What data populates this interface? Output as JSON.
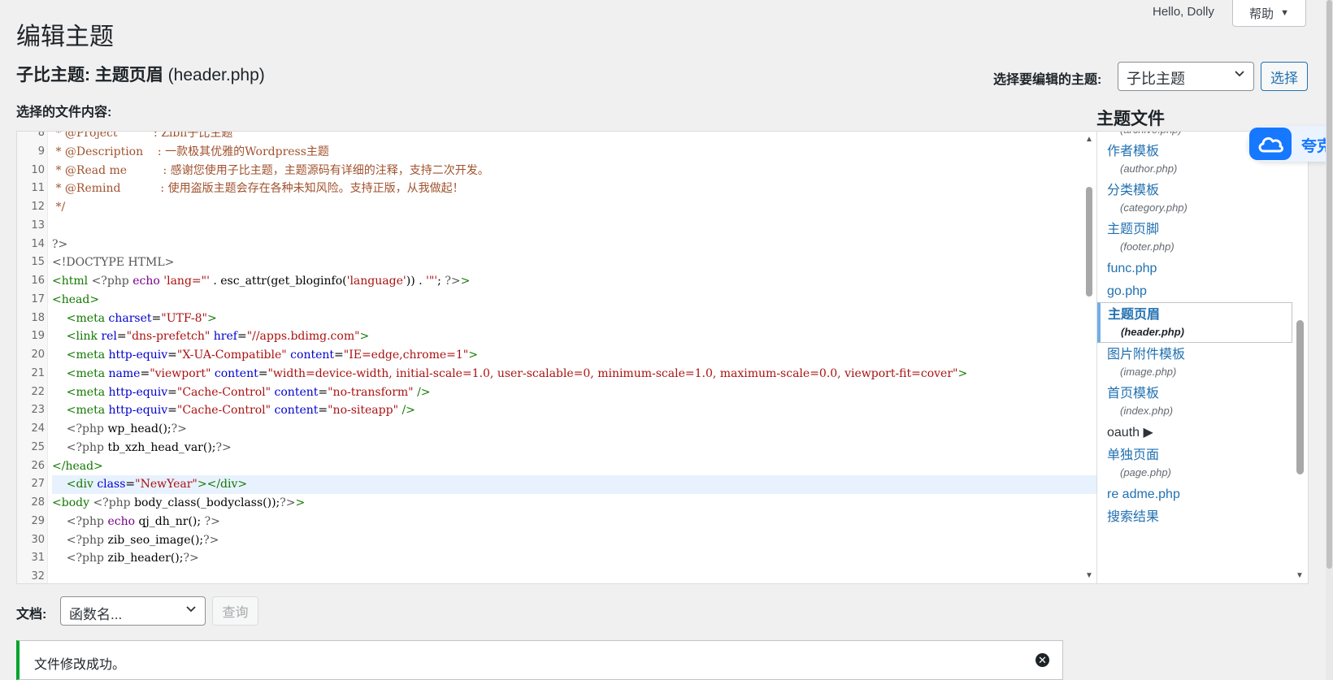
{
  "topbar": {
    "greeting": "Hello, Dolly",
    "help_label": "帮助",
    "help_caret": "▼"
  },
  "page": {
    "title": "编辑主题",
    "file_heading_theme": "子比主题: 主题页眉",
    "file_heading_file": "(header.php)",
    "select_theme_label": "选择要编辑的主题:",
    "selected_theme": "子比主题",
    "select_button": "选择",
    "content_label": "选择的文件内容:",
    "theme_files_title": "主题文件"
  },
  "editor": {
    "lines": [
      {
        "n": "8",
        "parts": [
          [
            "cm-comment",
            " * @Project          : Zibll子比主题"
          ]
        ]
      },
      {
        "n": "9",
        "parts": [
          [
            "cm-comment",
            " * @Description    : 一款极其优雅的Wordpress主题"
          ]
        ]
      },
      {
        "n": "10",
        "parts": [
          [
            "cm-comment",
            " * @Read me          : 感谢您使用子比主题，主题源码有详细的注释，支持二次开发。"
          ]
        ]
      },
      {
        "n": "11",
        "parts": [
          [
            "cm-comment",
            " * @Remind           : 使用盗版主题会存在各种未知风险。支持正版，从我做起！"
          ]
        ]
      },
      {
        "n": "12",
        "parts": [
          [
            "cm-comment",
            " */"
          ]
        ]
      },
      {
        "n": "13",
        "parts": []
      },
      {
        "n": "14",
        "parts": [
          [
            "cm-meta",
            "?>"
          ]
        ]
      },
      {
        "n": "15",
        "parts": [
          [
            "cm-meta",
            "<!DOCTYPE HTML>"
          ]
        ]
      },
      {
        "n": "16",
        "parts": [
          [
            "cm-tag",
            "<html "
          ],
          [
            "cm-meta",
            "<?php "
          ],
          [
            "cm-kw",
            "echo "
          ],
          [
            "cm-str",
            "'lang=\"' "
          ],
          [
            "cm-plain",
            ". esc_attr(get_bloginfo("
          ],
          [
            "cm-str",
            "'language'"
          ],
          [
            "cm-plain",
            ")) . "
          ],
          [
            "cm-str",
            "'\"'"
          ],
          [
            "cm-plain",
            "; "
          ],
          [
            "cm-meta",
            "?>"
          ],
          [
            "cm-tag",
            ">"
          ]
        ]
      },
      {
        "n": "17",
        "parts": [
          [
            "cm-tag",
            "<head>"
          ]
        ]
      },
      {
        "n": "18",
        "parts": [
          [
            "cm-tag",
            "    <meta "
          ],
          [
            "cm-attr",
            "charset"
          ],
          [
            "cm-plain",
            "="
          ],
          [
            "cm-str",
            "\"UTF-8\""
          ],
          [
            "cm-tag",
            ">"
          ]
        ]
      },
      {
        "n": "19",
        "parts": [
          [
            "cm-tag",
            "    <link "
          ],
          [
            "cm-attr",
            "rel"
          ],
          [
            "cm-plain",
            "="
          ],
          [
            "cm-str",
            "\"dns-prefetch\" "
          ],
          [
            "cm-attr",
            "href"
          ],
          [
            "cm-plain",
            "="
          ],
          [
            "cm-str",
            "\"//apps.bdimg.com\""
          ],
          [
            "cm-tag",
            ">"
          ]
        ]
      },
      {
        "n": "20",
        "parts": [
          [
            "cm-tag",
            "    <meta "
          ],
          [
            "cm-attr",
            "http-equiv"
          ],
          [
            "cm-plain",
            "="
          ],
          [
            "cm-str",
            "\"X-UA-Compatible\" "
          ],
          [
            "cm-attr",
            "content"
          ],
          [
            "cm-plain",
            "="
          ],
          [
            "cm-str",
            "\"IE=edge,chrome=1\""
          ],
          [
            "cm-tag",
            ">"
          ]
        ]
      },
      {
        "n": "21",
        "parts": [
          [
            "cm-tag",
            "    <meta "
          ],
          [
            "cm-attr",
            "name"
          ],
          [
            "cm-plain",
            "="
          ],
          [
            "cm-str",
            "\"viewport\" "
          ],
          [
            "cm-attr",
            "content"
          ],
          [
            "cm-plain",
            "="
          ],
          [
            "cm-str",
            "\"width=device-width, initial-scale=1.0, user-scalable=0, minimum-scale=1.0, maximum-scale=0.0, viewport-fit=cover\""
          ],
          [
            "cm-tag",
            ">"
          ]
        ]
      },
      {
        "n": "22",
        "parts": [
          [
            "cm-tag",
            "    <meta "
          ],
          [
            "cm-attr",
            "http-equiv"
          ],
          [
            "cm-plain",
            "="
          ],
          [
            "cm-str",
            "\"Cache-Control\" "
          ],
          [
            "cm-attr",
            "content"
          ],
          [
            "cm-plain",
            "="
          ],
          [
            "cm-str",
            "\"no-transform\" "
          ],
          [
            "cm-tag",
            "/>"
          ]
        ]
      },
      {
        "n": "23",
        "parts": [
          [
            "cm-tag",
            "    <meta "
          ],
          [
            "cm-attr",
            "http-equiv"
          ],
          [
            "cm-plain",
            "="
          ],
          [
            "cm-str",
            "\"Cache-Control\" "
          ],
          [
            "cm-attr",
            "content"
          ],
          [
            "cm-plain",
            "="
          ],
          [
            "cm-str",
            "\"no-siteapp\" "
          ],
          [
            "cm-tag",
            "/>"
          ]
        ]
      },
      {
        "n": "24",
        "parts": [
          [
            "cm-meta",
            "    <?php "
          ],
          [
            "cm-plain",
            "wp_head();"
          ],
          [
            "cm-meta",
            "?>"
          ]
        ]
      },
      {
        "n": "25",
        "parts": [
          [
            "cm-meta",
            "    <?php "
          ],
          [
            "cm-plain",
            "tb_xzh_head_var();"
          ],
          [
            "cm-meta",
            "?>"
          ]
        ]
      },
      {
        "n": "26",
        "parts": [
          [
            "cm-tag",
            "</head>"
          ]
        ]
      },
      {
        "n": "27",
        "active": true,
        "parts": [
          [
            "cm-tag",
            "    <div "
          ],
          [
            "cm-attr",
            "class"
          ],
          [
            "cm-plain",
            "="
          ],
          [
            "cm-str",
            "\"NewYear\""
          ],
          [
            "cm-tag",
            "></div>"
          ]
        ]
      },
      {
        "n": "28",
        "parts": [
          [
            "cm-tag",
            "<body "
          ],
          [
            "cm-meta",
            "<?php "
          ],
          [
            "cm-plain",
            "body_class(_bodyclass());"
          ],
          [
            "cm-meta",
            "?>"
          ],
          [
            "cm-tag",
            ">"
          ]
        ]
      },
      {
        "n": "29",
        "parts": [
          [
            "cm-meta",
            "    <?php "
          ],
          [
            "cm-kw",
            "echo "
          ],
          [
            "cm-plain",
            "qj_dh_nr(); "
          ],
          [
            "cm-meta",
            "?>"
          ]
        ]
      },
      {
        "n": "30",
        "parts": [
          [
            "cm-meta",
            "    <?php "
          ],
          [
            "cm-plain",
            "zib_seo_image();"
          ],
          [
            "cm-meta",
            "?>"
          ]
        ]
      },
      {
        "n": "31",
        "parts": [
          [
            "cm-meta",
            "    <?php "
          ],
          [
            "cm-plain",
            "zib_header();"
          ],
          [
            "cm-meta",
            "?>"
          ]
        ]
      },
      {
        "n": "32",
        "parts": []
      }
    ]
  },
  "file_list": {
    "items": [
      {
        "label": "",
        "php": "(archive.php)"
      },
      {
        "label": "作者模板",
        "php": "(author.php)"
      },
      {
        "label": "分类模板",
        "php": "(category.php)"
      },
      {
        "label": "主题页脚",
        "php": "(footer.php)"
      },
      {
        "label": "func.php",
        "php": ""
      },
      {
        "label": "go.php",
        "php": ""
      },
      {
        "label": "主题页眉",
        "php": "(header.php)",
        "current": true
      },
      {
        "label": "图片附件模板",
        "php": "(image.php)"
      },
      {
        "label": "首页模板",
        "php": "(index.php)"
      },
      {
        "label": "oauth ▶",
        "php": "",
        "plain": true
      },
      {
        "label": "单独页面",
        "php": "(page.php)"
      },
      {
        "label": "re adme.php",
        "php": ""
      },
      {
        "label": "搜索结果",
        "php": ""
      }
    ]
  },
  "float_widget": {
    "text": "夸克"
  },
  "docs": {
    "label": "文档:",
    "function_select": "函数名...",
    "query_button": "查询"
  },
  "notice": {
    "message": "文件修改成功。",
    "dismiss": "✕"
  },
  "colors": {
    "link": "#2271b1",
    "success": "#00a32a",
    "active_line": "#e8f2ff"
  }
}
